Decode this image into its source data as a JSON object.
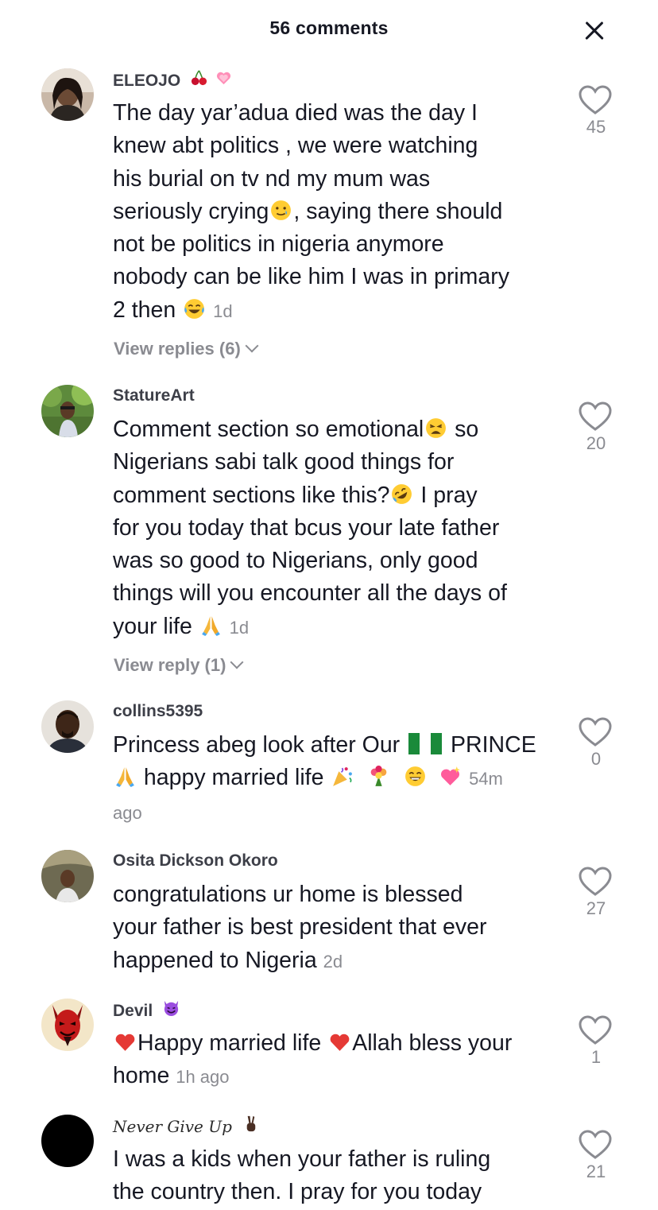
{
  "header": {
    "title": "56 comments"
  },
  "comments": [
    {
      "username": "ELEOJO",
      "lines": [
        "The day yar’adua died was the day I",
        "knew abt politics , we were watching",
        "his burial on tv nd my mum was",
        "seriously crying",
        ", saying there should",
        "not be politics in nigeria anymore",
        "nobody can be like him I was in primary",
        "2 then "
      ],
      "time": "1d",
      "replies": "View replies (6)",
      "likes": "45"
    },
    {
      "username": "StatureArt",
      "lines": [
        "Comment section so emotional",
        " so",
        "Nigerians sabi talk good things for",
        "comment sections like this?",
        " I pray",
        "for you today that bcus your late father",
        "was so good to Nigerians, only good",
        "things will you encounter all the days of",
        "your life "
      ],
      "time": "1d",
      "replies": "View reply (1)",
      "likes": "20"
    },
    {
      "username": "collins5395",
      "lines": [
        "Princess abeg look after Our ",
        " PRINCE",
        " happy married life "
      ],
      "time_a": "54m",
      "time_b": "ago",
      "likes": "0"
    },
    {
      "username": "Osita Dickson Okoro",
      "lines": [
        "congratulations ur home is blessed",
        "your father is best president that ever",
        "happened to Nigeria "
      ],
      "time": "2d",
      "likes": "27"
    },
    {
      "username": "Devil",
      "lines": [
        "Happy married life ",
        "Allah bless your",
        "home "
      ],
      "time": "1h ago",
      "likes": "1"
    },
    {
      "username": "Never Give Up",
      "lines": [
        "I was a kids when your father is ruling",
        "the country then. I pray for you today"
      ],
      "likes": "21"
    }
  ],
  "icons": {
    "close": "close-icon",
    "like": "heart-outline-icon",
    "chevron": "chevron-down-icon"
  },
  "colors": {
    "text_primary": "#161823",
    "text_secondary": "#8a8b91"
  }
}
